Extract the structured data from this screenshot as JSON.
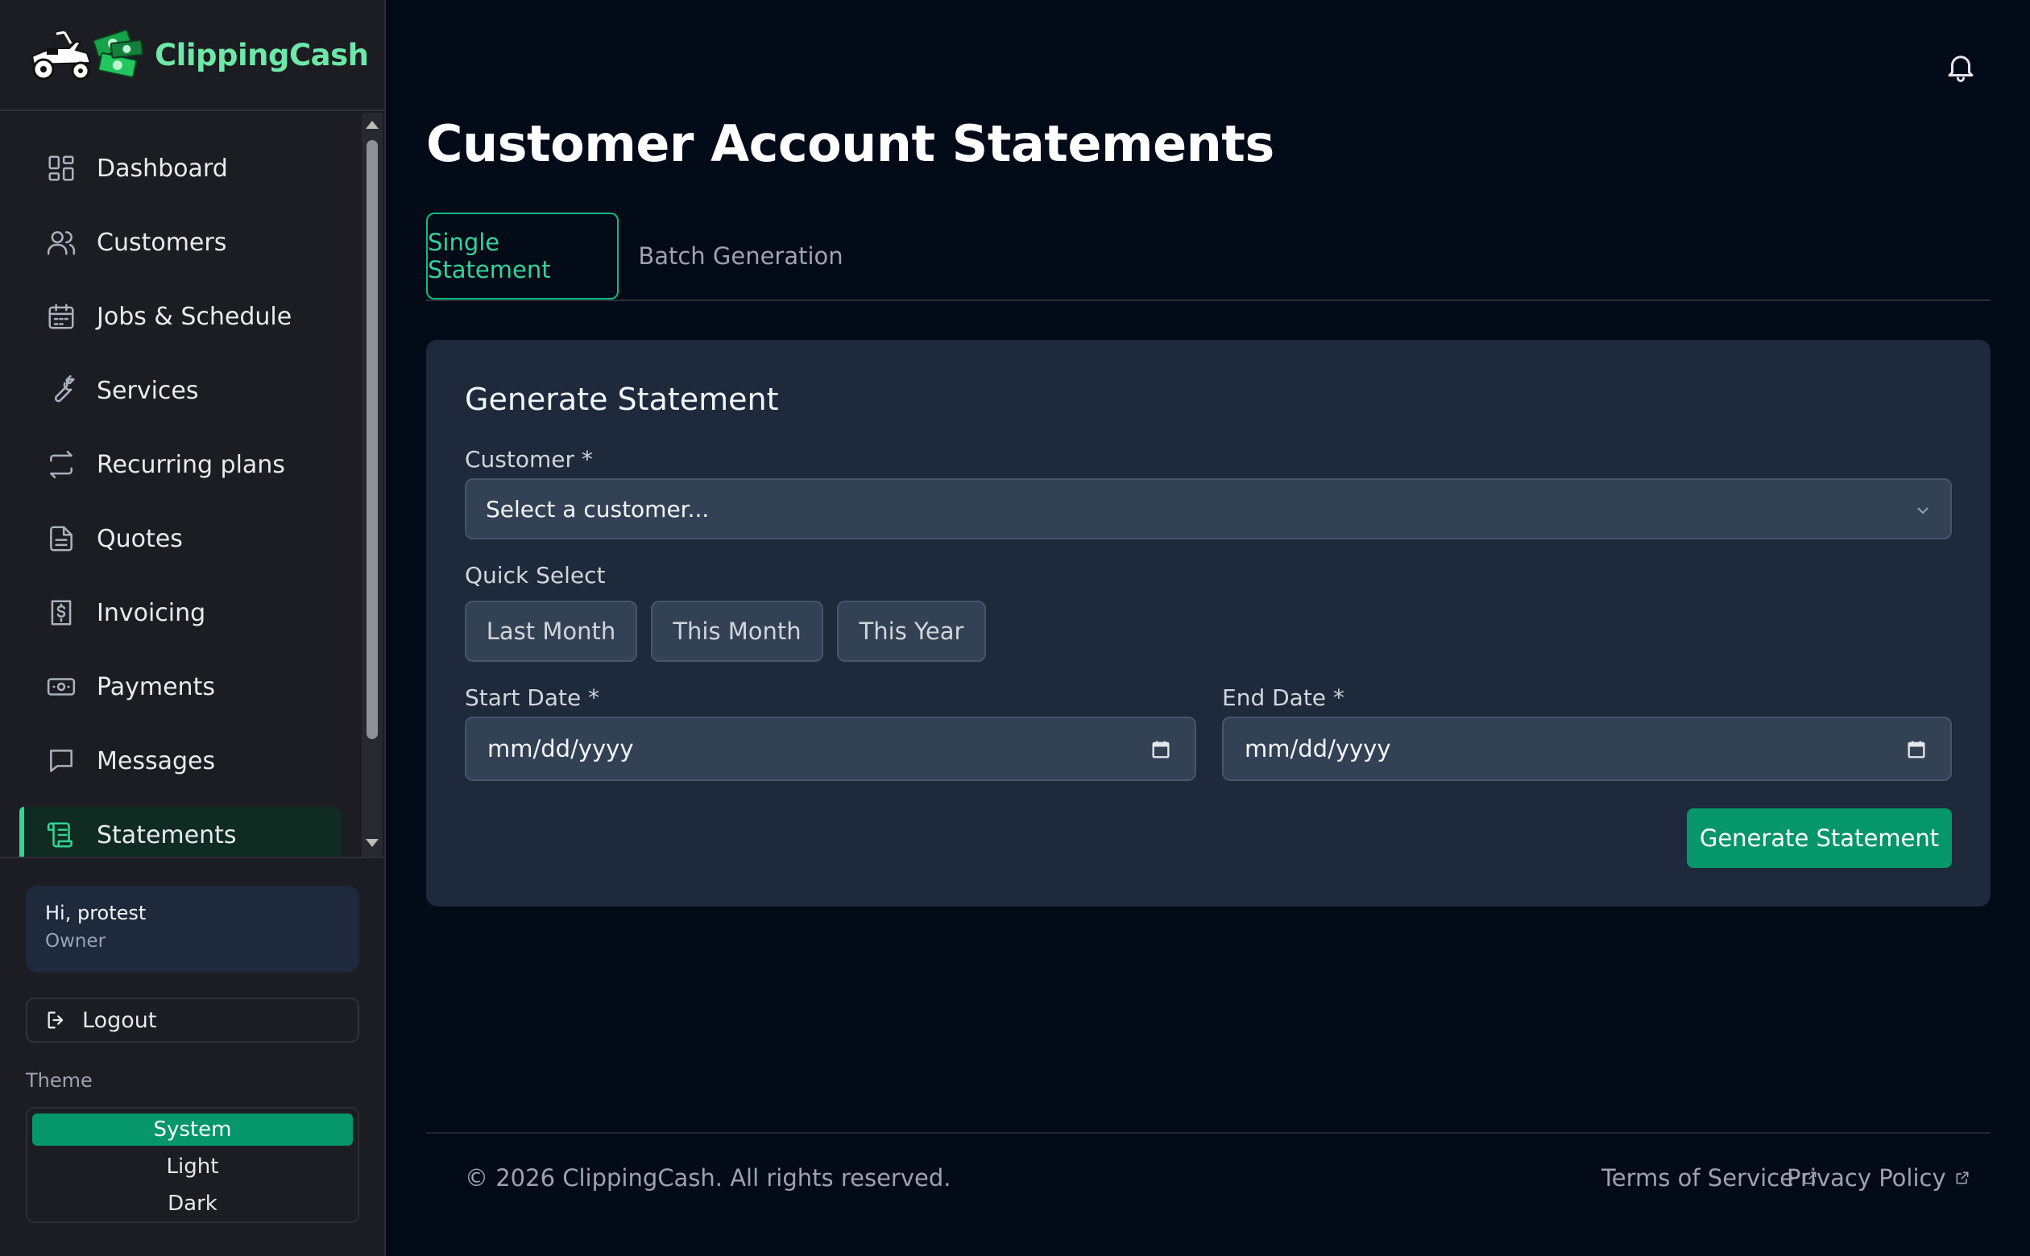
{
  "brand": {
    "name": "ClippingCash",
    "accent": "#6ee7a8"
  },
  "sidebar": {
    "items": [
      {
        "label": "Dashboard",
        "icon": "dashboard-icon"
      },
      {
        "label": "Customers",
        "icon": "users-icon"
      },
      {
        "label": "Jobs & Schedule",
        "icon": "calendar-icon"
      },
      {
        "label": "Services",
        "icon": "wrench-icon"
      },
      {
        "label": "Recurring plans",
        "icon": "repeat-icon"
      },
      {
        "label": "Quotes",
        "icon": "document-icon"
      },
      {
        "label": "Invoicing",
        "icon": "receipt-icon"
      },
      {
        "label": "Payments",
        "icon": "cash-icon"
      },
      {
        "label": "Messages",
        "icon": "chat-icon"
      },
      {
        "label": "Statements",
        "icon": "scroll-icon",
        "active": true
      }
    ],
    "user": {
      "greeting": "Hi, protest",
      "role": "Owner"
    },
    "logout_label": "Logout",
    "theme": {
      "label": "Theme",
      "options": [
        "System",
        "Light",
        "Dark"
      ],
      "selected": "System"
    }
  },
  "header": {
    "notification_icon": "bell-icon"
  },
  "main": {
    "title": "Customer Account Statements",
    "tabs": [
      {
        "label": "Single Statement",
        "active": true
      },
      {
        "label": "Batch Generation",
        "active": false
      }
    ],
    "form": {
      "title": "Generate Statement",
      "customer": {
        "label": "Customer *",
        "placeholder": "Select a customer..."
      },
      "quick_select": {
        "label": "Quick Select",
        "options": [
          "Last Month",
          "This Month",
          "This Year"
        ]
      },
      "start_date": {
        "label": "Start Date *",
        "placeholder": "mm/dd/yyyy"
      },
      "end_date": {
        "label": "End Date *",
        "placeholder": "mm/dd/yyyy"
      },
      "submit_label": "Generate Statement"
    }
  },
  "footer": {
    "copyright": "© 2026 ClippingCash. All rights reserved.",
    "links": [
      {
        "label": "Terms of Service",
        "icon": "external-link-icon"
      },
      {
        "label": "Privacy Policy",
        "icon": "external-link-icon"
      }
    ]
  },
  "colors": {
    "primary": "#059669",
    "active_tab": "#34d399",
    "background": "#030a18",
    "card": "#1e293b"
  }
}
